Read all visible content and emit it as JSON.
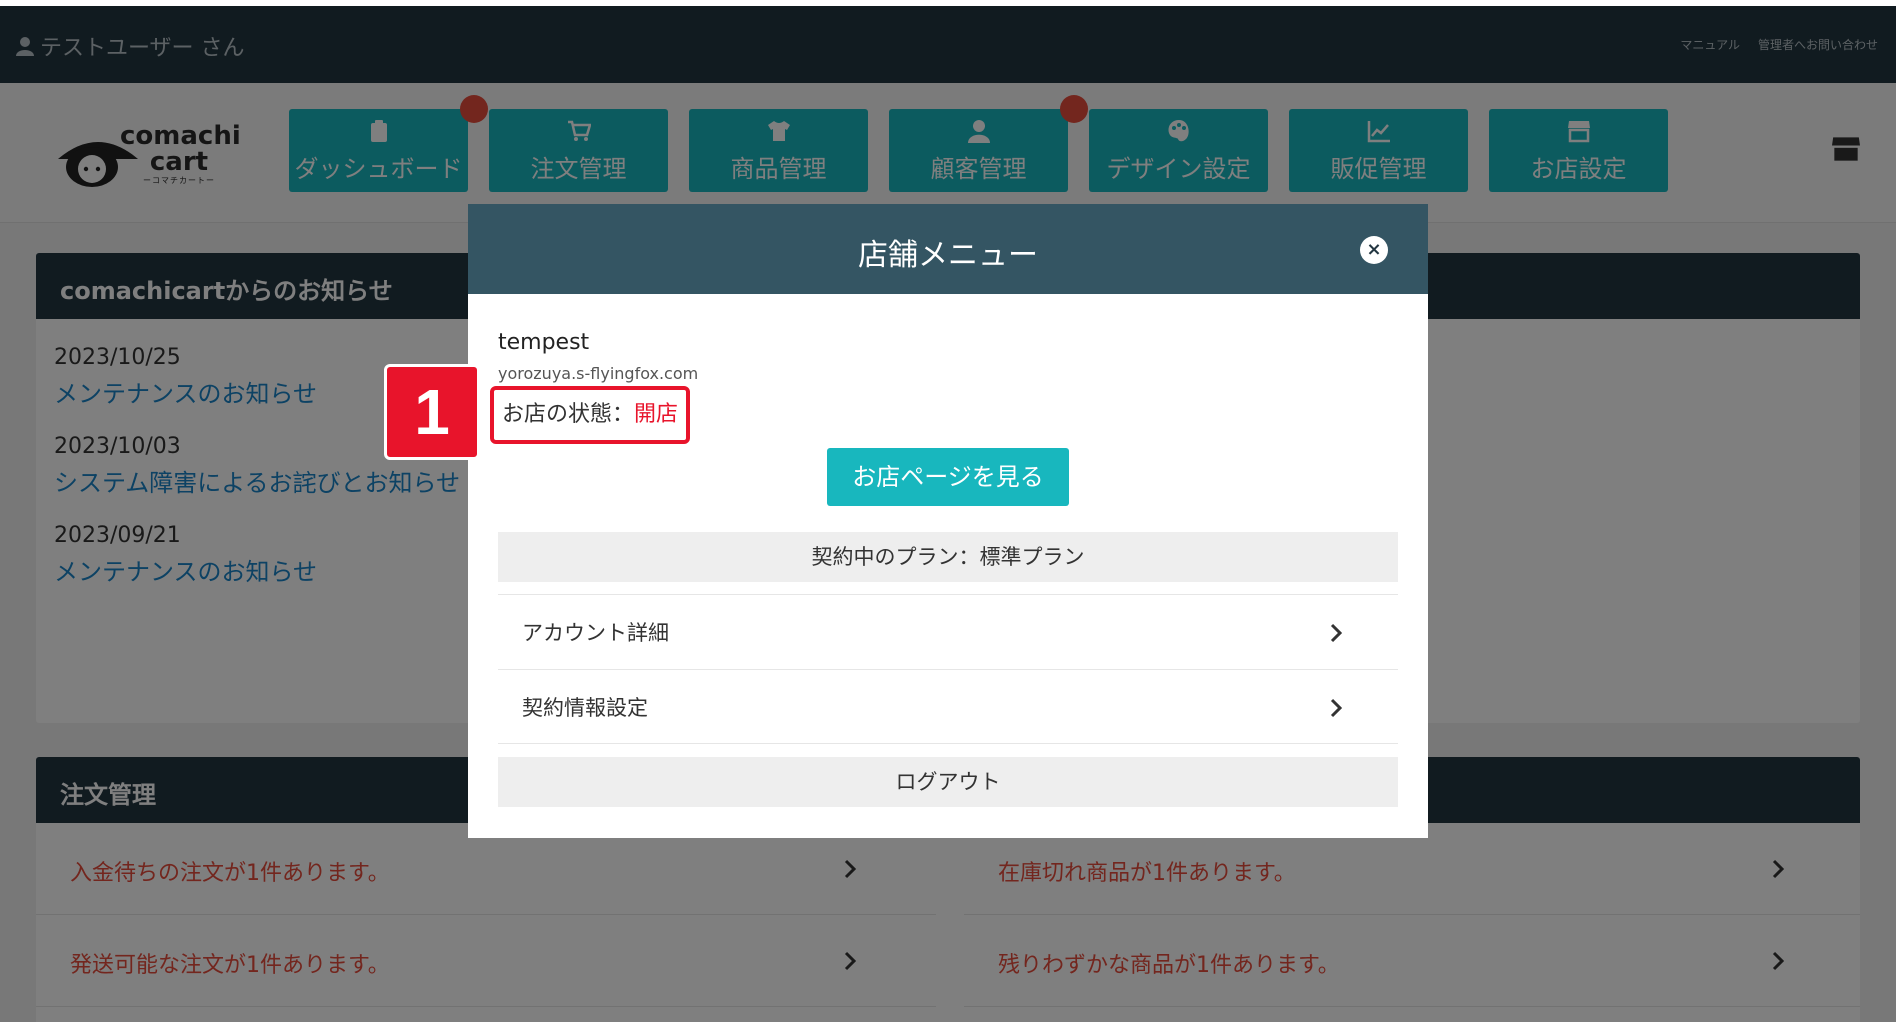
{
  "topbar": {
    "user": "テストユーザー さん",
    "manual": "マニュアル",
    "contact": "管理者へお問い合わせ"
  },
  "logo": {
    "brand_line1": "comachi",
    "brand_line2": "cart",
    "sub": "ーコマチカートー"
  },
  "nav": [
    {
      "label": "ダッシュボード",
      "icon": "clipboard-icon",
      "badge": true
    },
    {
      "label": "注文管理",
      "icon": "cart-icon",
      "badge": false
    },
    {
      "label": "商品管理",
      "icon": "tshirt-icon",
      "badge": false
    },
    {
      "label": "顧客管理",
      "icon": "user-icon",
      "badge": true
    },
    {
      "label": "デザイン設定",
      "icon": "palette-icon",
      "badge": false
    },
    {
      "label": "販促管理",
      "icon": "chart-icon",
      "badge": false
    },
    {
      "label": "お店設定",
      "icon": "store-icon",
      "badge": false
    }
  ],
  "news": {
    "heading": "comachicartからのお知らせ",
    "items": [
      {
        "date": "2023/10/25",
        "title": "メンテナンスのお知らせ"
      },
      {
        "date": "2023/10/03",
        "title": "システム障害によるお詫びとお知らせ"
      },
      {
        "date": "2023/09/21",
        "title": "メンテナンスのお知らせ"
      }
    ]
  },
  "orders": {
    "heading": "注文管理",
    "left": [
      "入金待ちの注文が1件あります。",
      "発送可能な注文が1件あります。"
    ],
    "right": [
      "在庫切れ商品が1件あります。",
      "残りわずかな商品が1件あります。"
    ]
  },
  "modal": {
    "title": "店舗メニュー",
    "close": "×",
    "store_name": "tempest",
    "store_url": "yorozuya.s-flyingfox.com",
    "status_label": "お店の状態：",
    "status_value": "開店",
    "view_button": "お店ページを見る",
    "plan": "契約中のプラン：標準プラン",
    "rows": [
      "アカウント詳細",
      "契約情報設定"
    ],
    "logout": "ログアウト"
  },
  "callout": {
    "number": "1"
  },
  "colors": {
    "accent": "#18b7be",
    "header": "#233641",
    "modal_header": "#345563",
    "highlight": "#e8142b"
  }
}
